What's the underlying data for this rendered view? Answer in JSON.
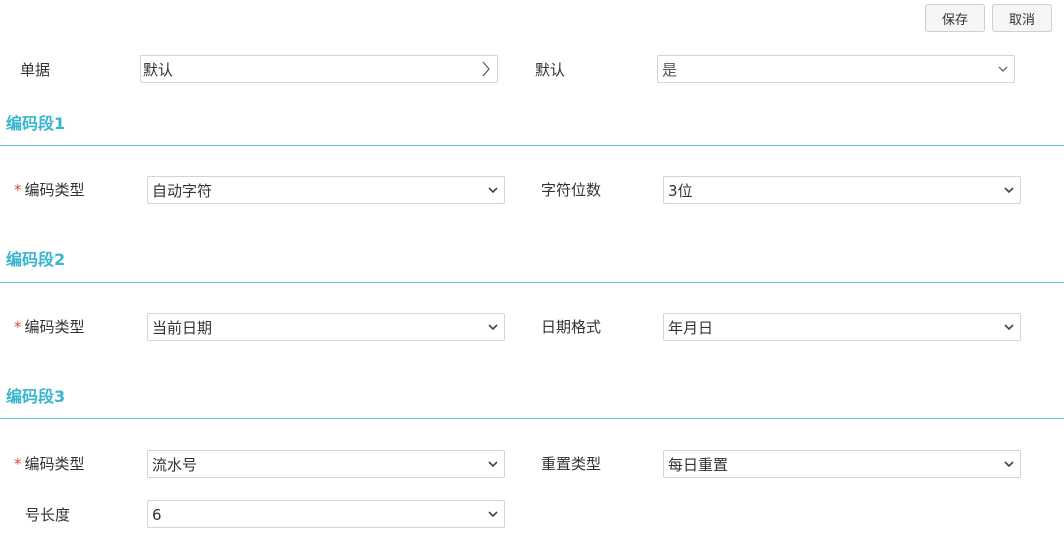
{
  "toolbar": {
    "save_label": "保存",
    "cancel_label": "取消"
  },
  "top": {
    "doc_label": "单据",
    "doc_value": "默认",
    "default_label": "默认",
    "default_value": "是"
  },
  "sections": [
    {
      "title": "编码段1",
      "type_label": "编码类型",
      "type_value": "自动字符",
      "param_label": "字符位数",
      "param_value": "3位"
    },
    {
      "title": "编码段2",
      "type_label": "编码类型",
      "type_value": "当前日期",
      "param_label": "日期格式",
      "param_value": "年月日"
    },
    {
      "title": "编码段3",
      "type_label": "编码类型",
      "type_value": "流水号",
      "param_label": "重置类型",
      "param_value": "每日重置",
      "length_label": "号长度",
      "length_value": "6"
    }
  ],
  "required_mark": "*",
  "colors": {
    "accent": "#3ab5cf",
    "required": "#e04848"
  }
}
